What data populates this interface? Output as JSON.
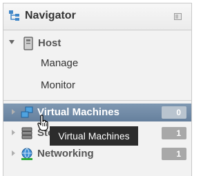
{
  "navigator": {
    "title": "Navigator",
    "host": {
      "label": "Host",
      "children": [
        {
          "label": "Manage"
        },
        {
          "label": "Monitor"
        }
      ]
    },
    "items": [
      {
        "label": "Virtual Machines",
        "count": "0",
        "icon": "virtual-machines-icon",
        "selected": true
      },
      {
        "label": "Storage",
        "count": "1",
        "icon": "storage-icon",
        "selected": false
      },
      {
        "label": "Networking",
        "count": "1",
        "icon": "networking-icon",
        "selected": false
      }
    ]
  },
  "tooltip": {
    "text": "Virtual Machines"
  },
  "colors": {
    "selected_row": "#7289a5",
    "badge": "#a8a8a8",
    "tooltip_bg": "#2c2c2c"
  }
}
